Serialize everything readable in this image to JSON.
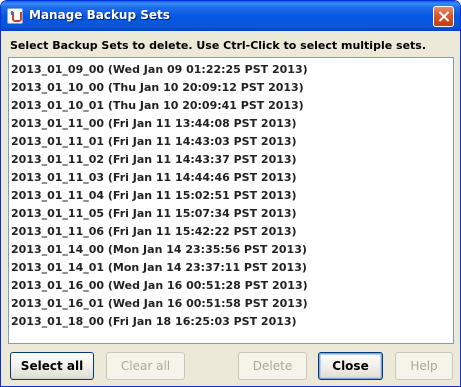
{
  "window": {
    "title": "Manage Backup Sets"
  },
  "instructions": "Select Backup Sets to delete. Use Ctrl-Click to select multiple sets.",
  "backup_sets": [
    "2013_01_09_00 (Wed Jan 09 01:22:25 PST 2013)",
    "2013_01_10_00 (Thu Jan 10 20:09:12 PST 2013)",
    "2013_01_10_01 (Thu Jan 10 20:09:41 PST 2013)",
    "2013_01_11_00 (Fri Jan 11 13:44:08 PST 2013)",
    "2013_01_11_01 (Fri Jan 11 14:43:03 PST 2013)",
    "2013_01_11_02 (Fri Jan 11 14:43:37 PST 2013)",
    "2013_01_11_03 (Fri Jan 11 14:44:46 PST 2013)",
    "2013_01_11_04 (Fri Jan 11 15:02:51 PST 2013)",
    "2013_01_11_05 (Fri Jan 11 15:07:34 PST 2013)",
    "2013_01_11_06 (Fri Jan 11 15:42:22 PST 2013)",
    "2013_01_14_00 (Mon Jan 14 23:35:56 PST 2013)",
    "2013_01_14_01 (Mon Jan 14 23:37:11 PST 2013)",
    "2013_01_16_00 (Wed Jan 16 00:51:28 PST 2013)",
    "2013_01_16_01 (Wed Jan 16 00:51:58 PST 2013)",
    "2013_01_18_00 (Fri Jan 18 16:25:03 PST 2013)"
  ],
  "buttons": {
    "select_all": "Select all",
    "clear_all": "Clear all",
    "delete": "Delete",
    "close": "Close",
    "help": "Help"
  }
}
